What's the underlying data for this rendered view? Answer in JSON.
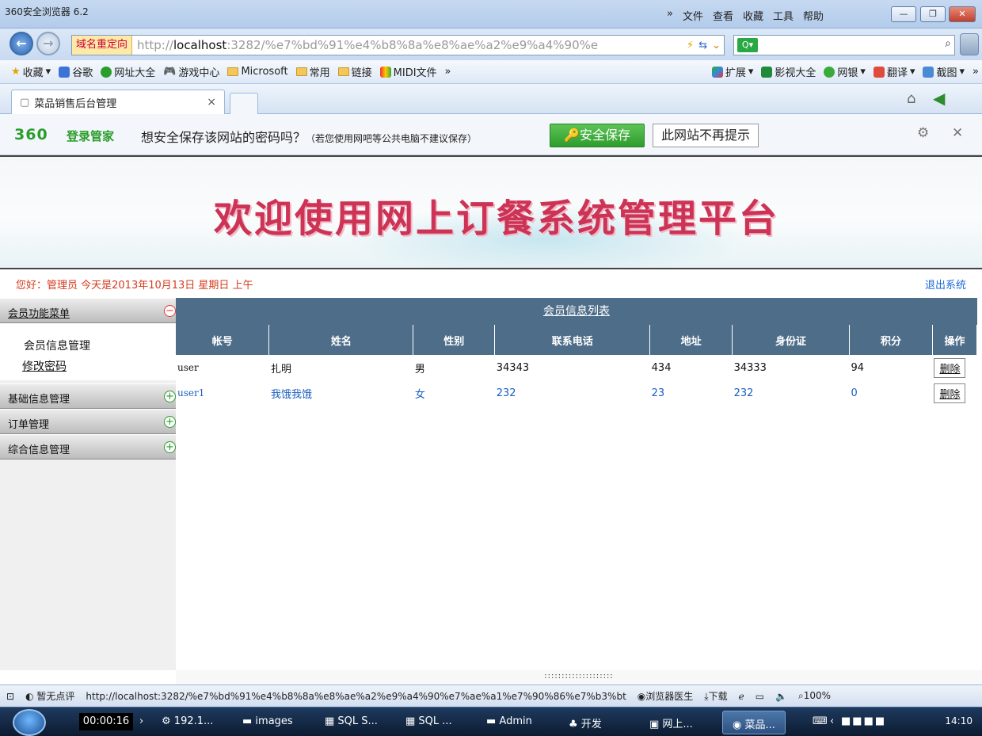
{
  "browser": {
    "title": "360安全浏览器 6.2",
    "menus": [
      "»",
      "文件",
      "查看",
      "收藏",
      "工具",
      "帮助"
    ],
    "redirect_label": "域名重定向",
    "url_prefix": "http://",
    "url_host": "localhost",
    "url_rest": ":3282/%e7%bd%91%e4%b8%8a%e8%ae%a2%e9%a4%90%e",
    "search_engine_icon": "search-engine-icon"
  },
  "favorites": {
    "items": [
      "收藏",
      "谷歌",
      "网址大全",
      "游戏中心",
      "Microsoft",
      "常用",
      "链接",
      "MIDI文件",
      "»"
    ],
    "right_items": [
      "扩展",
      "影视大全",
      "网银",
      "翻译",
      "截图",
      "»"
    ]
  },
  "tab": {
    "title": "菜品销售后台管理",
    "close": "×"
  },
  "password_bar": {
    "logo": "360",
    "logo_text": "登录管家",
    "message": "想安全保存该网站的密码吗？",
    "note": "（若您使用网吧等公共电脑不建议保存）",
    "save_label": "安全保存",
    "dismiss_label": "此网站不再提示"
  },
  "banner": {
    "title": "欢迎使用网上订餐系统管理平台"
  },
  "greeting": {
    "text": "您好：管理员   今天是2013年10月13日  星期日  上午",
    "logout": "退出系统"
  },
  "sidebar": {
    "sections": [
      {
        "label": "会员功能菜单",
        "expanded": true,
        "items": [
          "会员信息管理",
          "修改密码"
        ]
      },
      {
        "label": "基础信息管理",
        "expanded": false
      },
      {
        "label": "订单管理",
        "expanded": false
      },
      {
        "label": "综合信息管理",
        "expanded": false
      }
    ]
  },
  "main": {
    "caption": "会员信息列表",
    "columns": [
      "帐号",
      "姓名",
      "性别",
      "联系电话",
      "地址",
      "身份证",
      "积分",
      "操作"
    ],
    "rows": [
      [
        "user",
        "扎明",
        "男",
        "34343",
        "434",
        "34333",
        "94",
        "删除"
      ],
      [
        "user1",
        "我饿我饿",
        "女",
        "232",
        "23",
        "232",
        "0",
        "删除"
      ]
    ],
    "splitter": "::::::::::::::::::::"
  },
  "statusbar": {
    "rating": "暂无点评",
    "url": "http://localhost:3282/%e7%bd%91%e4%b8%8a%e8%ae%a2%e9%a4%90%e7%ae%a1%e7%90%86%e7%b3%bt",
    "doctor": "浏览器医生",
    "download": "下载",
    "zoom": "100%"
  },
  "taskbar": {
    "timer": "00:00:16",
    "tasks": [
      "192.1...",
      "images",
      "SQL S...",
      "SQL ...",
      "Admin",
      "开发",
      "网上...",
      "菜品..."
    ],
    "active_index": 7,
    "clock": "14:10"
  }
}
